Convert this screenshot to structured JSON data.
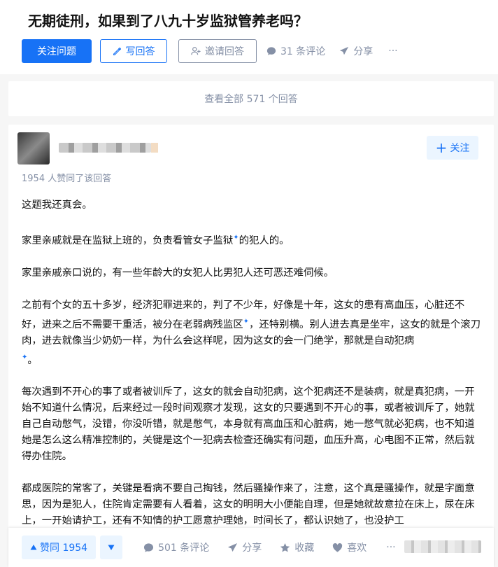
{
  "question": {
    "title": "无期徒刑，如果到了八九十岁监狱管养老吗？",
    "follow_label": "关注问题",
    "write_label": "写回答",
    "invite_label": "邀请回答",
    "comments_label": "31 条评论",
    "share_label": "分享",
    "more_label": "···"
  },
  "view_all_label": "查看全部 571 个回答",
  "answer": {
    "follow_label": "关注",
    "upvote_line": "1954 人赞同了该回答",
    "paragraphs": [
      "这题我还真会。",
      "家里亲戚就是在监狱上班的，负责看管女子监狱",
      "的犯人的。",
      "家里亲戚亲口说的，有一些年龄大的女犯人比男犯人还可恶还难伺候。",
      "之前有个女的五十多岁，经济犯罪进来的，判了不少年，好像是十年，这女的患有高血压，心脏还不好，进来之后不需要干重活，被分在老弱病残监区",
      "，还特别横。别人进去真是坐牢，这女的就是个滚刀肉，进去就像当少奶奶一样，为什么会这样呢，因为这女的会一门绝学，那就是自动犯病",
      "。",
      "每次遇到不开心的事了或者被训斥了，这女的就会自动犯病，这个犯病还不是装病，就是真犯病，一开始不知道什么情况，后来经过一段时间观察才发现，这女的只要遇到不开心的事，或者被训斥了，她就自己自动憋气，没错，你没听错，就是憋气，本身就有高血压和心脏病，她一憋气就必犯病，也不知道她是怎么这么精准控制的，关键是这个一犯病去检查还确实有问题，血压升高，心电图不正常，然后就得办住院。",
      "都成医院的常客了，关键是看病不要自己掏钱，然后骚操作来了，注意，这个真是骚操作，就是字面意思，因为是犯人，住院肯定需要有人看着，这女的明明大小便能自理，但是她就故意拉在床上，尿在床上，一开始请护工，还有不知情的护工愿意护理她，时间长了，都认识她了，也没护工"
    ]
  },
  "bottom_bar": {
    "upvote_label": "赞同 1954",
    "comments_label": "501 条评论",
    "share_label": "分享",
    "favorite_label": "收藏",
    "like_label": "喜欢",
    "more_label": "···"
  },
  "colors": {
    "brand": "#1772f6",
    "muted": "#8590a6",
    "light_brand_bg": "#ebf5ff"
  }
}
